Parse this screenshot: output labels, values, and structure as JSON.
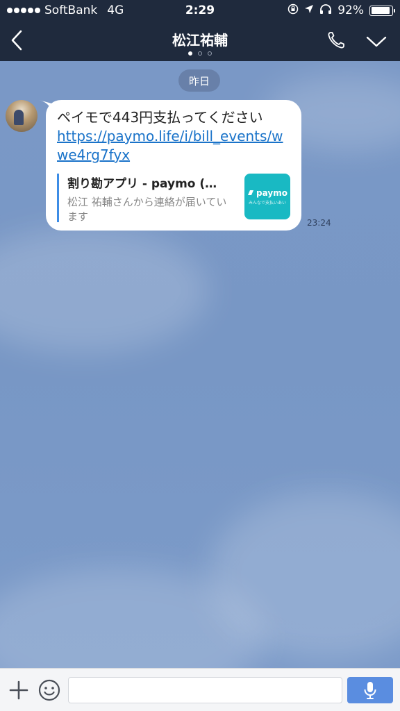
{
  "status_bar": {
    "carrier": "SoftBank",
    "network": "4G",
    "time": "2:29",
    "battery": "92%",
    "battery_level": 0.92
  },
  "header": {
    "title": "松江祐輔",
    "page_count": 3,
    "active_page": 1
  },
  "chat": {
    "date_label": "昨日",
    "message": {
      "text": "ペイモで443円支払ってください",
      "link": "https://paymo.life/i/bill_events/wwe4rg7fyx",
      "time": "23:24",
      "preview": {
        "title": "割り勘アプリ - paymo (…",
        "description": "松江 祐輔さんから連絡が届いています",
        "thumb_logo": "paymo",
        "thumb_tagline": "みんなで支払いあい"
      }
    }
  },
  "input_bar": {
    "placeholder": ""
  },
  "colors": {
    "header_bg": "#1f2a3d",
    "chat_bg": "#7a98c6",
    "link": "#1a73c9",
    "preview_accent": "#3d8de6",
    "paymo_teal": "#19b9c3",
    "mic_button": "#5a8de0"
  },
  "icons": [
    "back-chevron-icon",
    "phone-icon",
    "chevron-down-icon",
    "plus-icon",
    "emoji-icon",
    "microphone-icon",
    "location-arrow-icon",
    "headphones-icon",
    "rotation-lock-icon"
  ]
}
